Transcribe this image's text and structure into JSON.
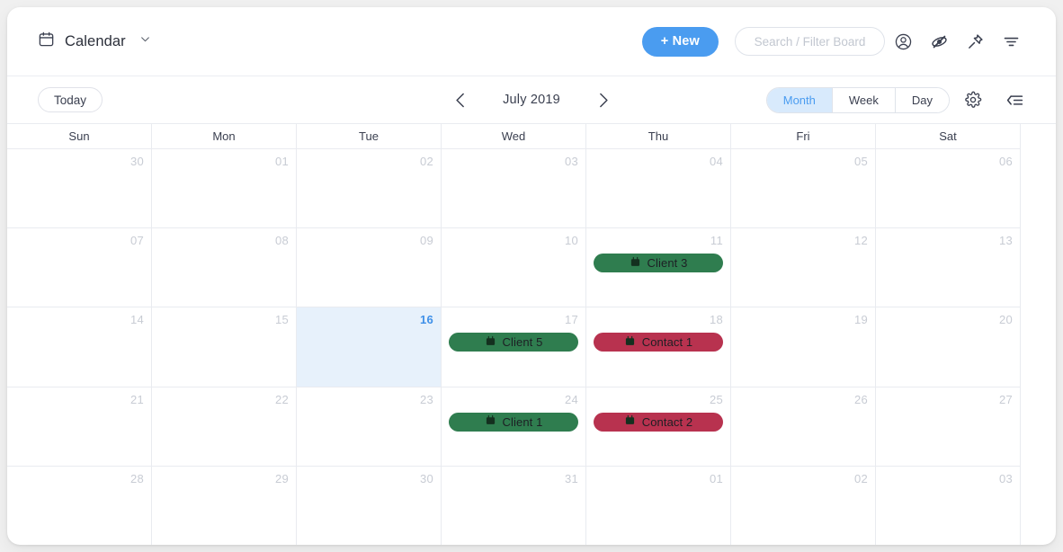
{
  "window": {
    "accent_blue": "#4a9cf0",
    "event_green": "#2f7d4f",
    "event_crimson": "#b8324f",
    "today_cell_bg": "#e7f1fb"
  },
  "topbar": {
    "board_icon": "calendar-icon",
    "board_title": "Calendar",
    "board_dropdown_icon": "chevron-down-icon",
    "new_button_label": "+ New",
    "search_placeholder": "Search / Filter Board",
    "search_value": "",
    "icons": [
      {
        "name": "account-circle-icon"
      },
      {
        "name": "eye-off-icon"
      },
      {
        "name": "pin-icon"
      },
      {
        "name": "filter-icon"
      }
    ]
  },
  "navbar": {
    "today_label": "Today",
    "prev_icon": "chevron-left-icon",
    "next_icon": "chevron-right-icon",
    "period_label": "July 2019",
    "views": [
      {
        "label": "Month",
        "active": true
      },
      {
        "label": "Week",
        "active": false
      },
      {
        "label": "Day",
        "active": false
      }
    ],
    "settings_icon": "gear-icon",
    "collapse_icon": "collapse-left-icon"
  },
  "calendar": {
    "day_headers": [
      "Sun",
      "Mon",
      "Tue",
      "Wed",
      "Thu",
      "Fri",
      "Sat"
    ],
    "weeks": [
      {
        "days": [
          {
            "num": "30",
            "today": false,
            "events": []
          },
          {
            "num": "01",
            "today": false,
            "events": []
          },
          {
            "num": "02",
            "today": false,
            "events": []
          },
          {
            "num": "03",
            "today": false,
            "events": []
          },
          {
            "num": "04",
            "today": false,
            "events": []
          },
          {
            "num": "05",
            "today": false,
            "events": []
          },
          {
            "num": "06",
            "today": false,
            "events": []
          }
        ]
      },
      {
        "days": [
          {
            "num": "07",
            "today": false,
            "events": []
          },
          {
            "num": "08",
            "today": false,
            "events": []
          },
          {
            "num": "09",
            "today": false,
            "events": []
          },
          {
            "num": "10",
            "today": false,
            "events": []
          },
          {
            "num": "11",
            "today": false,
            "events": [
              {
                "label": "Client 3",
                "color": "green",
                "icon": "calendar-event-icon"
              }
            ]
          },
          {
            "num": "12",
            "today": false,
            "events": []
          },
          {
            "num": "13",
            "today": false,
            "events": []
          }
        ]
      },
      {
        "days": [
          {
            "num": "14",
            "today": false,
            "events": []
          },
          {
            "num": "15",
            "today": false,
            "events": []
          },
          {
            "num": "16",
            "today": true,
            "events": []
          },
          {
            "num": "17",
            "today": false,
            "events": [
              {
                "label": "Client 5",
                "color": "green",
                "icon": "calendar-event-icon"
              }
            ]
          },
          {
            "num": "18",
            "today": false,
            "events": [
              {
                "label": "Contact 1",
                "color": "crimson",
                "icon": "calendar-event-icon"
              }
            ]
          },
          {
            "num": "19",
            "today": false,
            "events": []
          },
          {
            "num": "20",
            "today": false,
            "events": []
          }
        ]
      },
      {
        "days": [
          {
            "num": "21",
            "today": false,
            "events": []
          },
          {
            "num": "22",
            "today": false,
            "events": []
          },
          {
            "num": "23",
            "today": false,
            "events": []
          },
          {
            "num": "24",
            "today": false,
            "events": [
              {
                "label": "Client 1",
                "color": "green",
                "icon": "calendar-event-icon"
              }
            ]
          },
          {
            "num": "25",
            "today": false,
            "events": [
              {
                "label": "Contact 2",
                "color": "crimson",
                "icon": "calendar-event-icon"
              }
            ]
          },
          {
            "num": "26",
            "today": false,
            "events": []
          },
          {
            "num": "27",
            "today": false,
            "events": []
          }
        ]
      },
      {
        "days": [
          {
            "num": "28",
            "today": false,
            "events": []
          },
          {
            "num": "29",
            "today": false,
            "events": []
          },
          {
            "num": "30",
            "today": false,
            "events": []
          },
          {
            "num": "31",
            "today": false,
            "events": []
          },
          {
            "num": "01",
            "today": false,
            "events": []
          },
          {
            "num": "02",
            "today": false,
            "events": []
          },
          {
            "num": "03",
            "today": false,
            "events": []
          }
        ]
      }
    ]
  }
}
